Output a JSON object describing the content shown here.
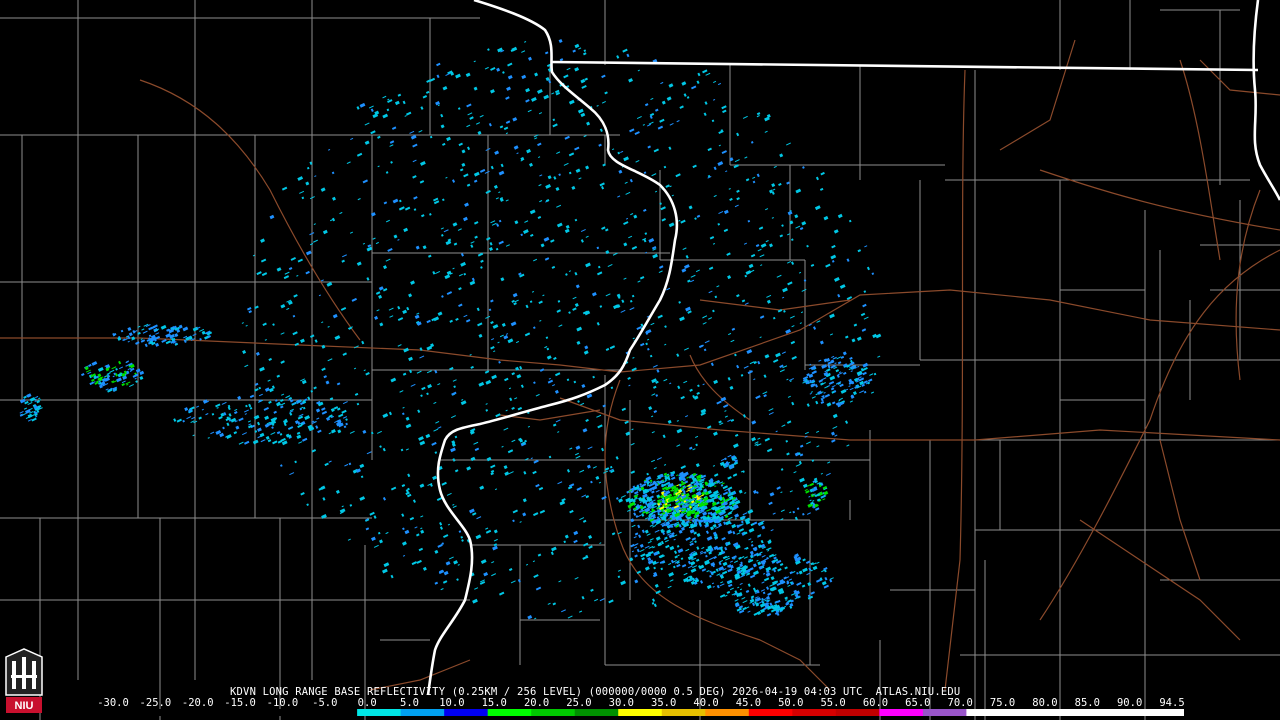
{
  "product": {
    "caption": "KDVN LONG RANGE BASE REFLECTIVITY (0.25KM / 256 LEVEL) (000000/0000 0.5 DEG) 2026-04-19 04:03 UTC  ATLAS.NIU.EDU"
  },
  "logo": {
    "text": "NIU",
    "icon": "niu-castle-logo-icon"
  },
  "scale": {
    "labels": [
      "-30.0",
      "-25.0",
      "-20.0",
      "-15.0",
      "-10.0",
      "-5.0",
      "0.0",
      "5.0",
      "10.0",
      "15.0",
      "20.0",
      "25.0",
      "30.0",
      "35.0",
      "40.0",
      "45.0",
      "50.0",
      "55.0",
      "60.0",
      "65.0",
      "70.0",
      "75.0",
      "80.0",
      "85.0",
      "90.0",
      "94.5"
    ],
    "colors": [
      "#000000",
      "#000000",
      "#000000",
      "#000000",
      "#000000",
      "#000000",
      "#00e6e6",
      "#00a0f0",
      "#0000f0",
      "#00ff00",
      "#00c800",
      "#009000",
      "#ffff00",
      "#e6c000",
      "#ff9000",
      "#ff0000",
      "#d60000",
      "#c00000",
      "#ff00ff",
      "#9955c9",
      "#ffffff",
      "#ffffff",
      "#ffffff",
      "#ffffff",
      "#ffffff"
    ]
  },
  "colors": {
    "background": "#000000",
    "county_lines": "#9a9a9a",
    "state_lines": "#ffffff",
    "highways": "#8b4a2b",
    "echo_light": "#00c8e6",
    "echo_mid": "#1e90ff",
    "echo_strong": "#00e000",
    "echo_heavy": "#ffff00"
  }
}
